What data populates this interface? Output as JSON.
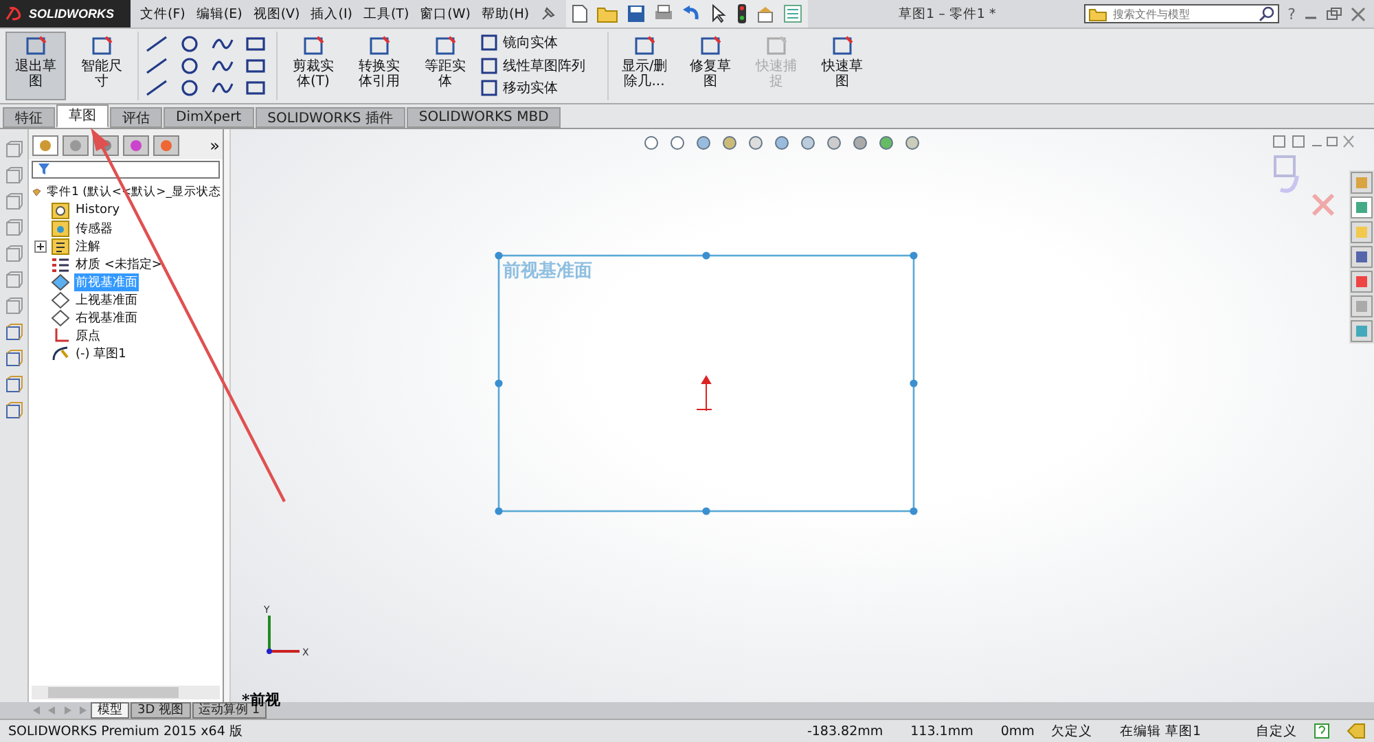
{
  "title_bar": {
    "logo": "SOLIDWORKS",
    "menus": [
      "文件(F)",
      "编辑(E)",
      "视图(V)",
      "插入(I)",
      "工具(T)",
      "窗口(W)",
      "帮助(H)"
    ],
    "document_title": "草图1 – 零件1 *",
    "search": {
      "placeholder": "搜索文件与模型"
    },
    "help": "?"
  },
  "ribbon": {
    "items": [
      {
        "kind": "large",
        "label": "退出草图",
        "selected": true,
        "disabled": false
      },
      {
        "kind": "large",
        "label": "智能尺寸",
        "selected": false,
        "disabled": false
      },
      {
        "kind": "tools"
      },
      {
        "kind": "large",
        "label": "剪裁实体(T)",
        "selected": false,
        "disabled": false
      },
      {
        "kind": "large",
        "label": "转换实体引用",
        "selected": false,
        "disabled": false
      },
      {
        "kind": "large",
        "label": "等距实体",
        "selected": false,
        "disabled": false
      },
      {
        "kind": "list",
        "entries": [
          "镜向实体",
          "线性草图阵列",
          "移动实体"
        ]
      },
      {
        "kind": "large",
        "label": "显示/删除几...",
        "selected": false,
        "disabled": false
      },
      {
        "kind": "large",
        "label": "修复草图",
        "selected": false,
        "disabled": false
      },
      {
        "kind": "large",
        "label": "快速捕捉",
        "selected": false,
        "disabled": true
      },
      {
        "kind": "large",
        "label": "快速草图",
        "selected": false,
        "disabled": false
      }
    ]
  },
  "tabs": [
    {
      "label": "特征",
      "selected": false
    },
    {
      "label": "草图",
      "selected": true
    },
    {
      "label": "评估",
      "selected": false
    },
    {
      "label": "DimXpert",
      "selected": false
    },
    {
      "label": "SOLIDWORKS 插件",
      "selected": false
    },
    {
      "label": "SOLIDWORKS MBD",
      "selected": false
    }
  ],
  "feature_tree": {
    "more_tabs": "»",
    "root": {
      "label": "零件1 (默认<<默认>_显示状态",
      "children": [
        {
          "kind": "history",
          "label": "History",
          "selected": false
        },
        {
          "kind": "sensor",
          "label": "传感器",
          "selected": false
        },
        {
          "kind": "annotation",
          "label": "注解",
          "selected": false,
          "expanded": false
        },
        {
          "kind": "material",
          "label": "材质 <未指定>",
          "selected": false
        },
        {
          "kind": "plane",
          "label": "前视基准面",
          "selected": true
        },
        {
          "kind": "plane",
          "label": "上视基准面",
          "selected": false
        },
        {
          "kind": "plane",
          "label": "右视基准面",
          "selected": false
        },
        {
          "kind": "origin",
          "label": "原点",
          "selected": false
        },
        {
          "kind": "sketch",
          "label": "(-) 草图1",
          "selected": false
        }
      ]
    }
  },
  "canvas": {
    "plane_label": "前视基准面",
    "view_label": "*前视",
    "axis_y": "Y",
    "axis_x": "X"
  },
  "bottom_tabs": [
    {
      "label": "模型",
      "selected": true
    },
    {
      "label": "3D 视图",
      "selected": false
    },
    {
      "label": "运动算例 1",
      "selected": false
    }
  ],
  "status_bar": {
    "product": "SOLIDWORKS Premium 2015 x64 版",
    "x": "-183.82mm",
    "y": "113.1mm",
    "z": "0mm",
    "state": "欠定义",
    "editing": "在编辑 草图1",
    "units": "自定义"
  }
}
